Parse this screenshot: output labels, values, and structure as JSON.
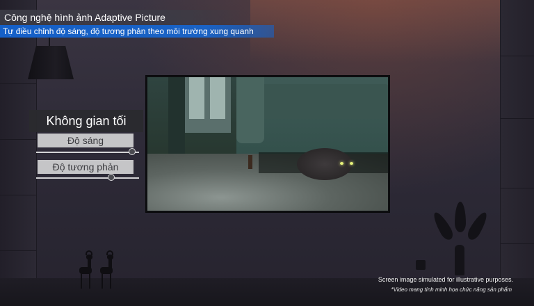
{
  "header": {
    "title": "Công nghệ hình ảnh Adaptive Picture",
    "subtitle": "Tự điều chỉnh độ sáng, độ tương phản theo môi trường xung quanh"
  },
  "mode_panel": {
    "label": "Không gian tối",
    "controls": [
      {
        "label": "Độ sáng",
        "value": 0.93
      },
      {
        "label": "Độ tương phản",
        "value": 0.73
      }
    ]
  },
  "footer": {
    "disclaimer_en": "Screen image simulated for illustrative purposes.",
    "disclaimer_vi": "*Video mang tính minh họa chức năng sản phẩm"
  },
  "colors": {
    "subtitle_bg": "#1560c8",
    "panel_bg": "#2a2a2e",
    "control_label_bg": "#d2d2d4"
  },
  "icons": {
    "lamp": "pendant-lamp-icon",
    "deer": "deer-figurine-icon",
    "plant": "plant-vase-icon"
  }
}
